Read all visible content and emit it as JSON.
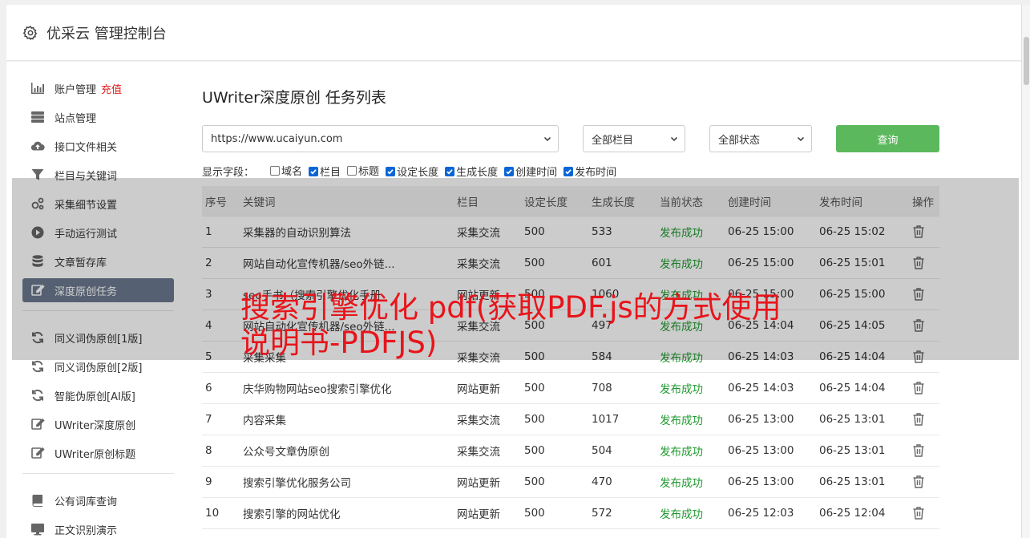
{
  "header": {
    "title": "优采云 管理控制台"
  },
  "sidebar": {
    "group1": [
      {
        "label": "账户管理",
        "badge": "充值",
        "icon": "bar-chart-icon"
      },
      {
        "label": "站点管理",
        "icon": "server-icon"
      },
      {
        "label": "接口文件相关",
        "icon": "cloud-upload-icon"
      },
      {
        "label": "栏目与关键词",
        "icon": "filter-icon"
      },
      {
        "label": "采集细节设置",
        "icon": "gears-icon"
      },
      {
        "label": "手动运行测试",
        "icon": "play-circle-icon"
      },
      {
        "label": "文章暂存库",
        "icon": "database-icon"
      },
      {
        "label": "深度原创任务",
        "icon": "edit-icon",
        "active": true
      }
    ],
    "group2": [
      {
        "label": "同义词伪原创[1版]",
        "icon": "refresh-icon"
      },
      {
        "label": "同义词伪原创[2版]",
        "icon": "refresh-icon"
      },
      {
        "label": "智能伪原创[AI版]",
        "icon": "refresh-icon"
      },
      {
        "label": "UWriter深度原创",
        "icon": "edit-icon"
      },
      {
        "label": "UWriter原创标题",
        "icon": "edit-icon"
      }
    ],
    "group3": [
      {
        "label": "公有词库查询",
        "icon": "book-icon"
      },
      {
        "label": "正文识别演示",
        "icon": "monitor-icon"
      }
    ]
  },
  "page": {
    "title": "UWriter深度原创 任务列表"
  },
  "filters": {
    "site": "https://www.ucaiyun.com",
    "column": "全部栏目",
    "status": "全部状态",
    "query_label": "查询"
  },
  "fields": {
    "label": "显示字段：",
    "options": [
      {
        "label": "域名",
        "checked": false
      },
      {
        "label": "栏目",
        "checked": true
      },
      {
        "label": "标题",
        "checked": false
      },
      {
        "label": "设定长度",
        "checked": true
      },
      {
        "label": "生成长度",
        "checked": true
      },
      {
        "label": "创建时间",
        "checked": true
      },
      {
        "label": "发布时间",
        "checked": true
      }
    ]
  },
  "table": {
    "headers": [
      "序号",
      "关键词",
      "栏目",
      "设定长度",
      "生成长度",
      "当前状态",
      "创建时间",
      "发布时间",
      "操作"
    ],
    "rows": [
      [
        "1",
        "采集器的自动识别算法",
        "采集交流",
        "500",
        "533",
        "发布成功",
        "06-25 15:00",
        "06-25 15:02"
      ],
      [
        "2",
        "网站自动化宣传机器/seo外链...",
        "采集交流",
        "500",
        "601",
        "发布成功",
        "06-25 15:00",
        "06-25 15:01"
      ],
      [
        "3",
        "seo手书（搜索引擎优化手册",
        "网站更新",
        "500",
        "1060",
        "发布成功",
        "06-25 15:00",
        "06-25 15:00"
      ],
      [
        "4",
        "网站自动化宣传机器/seo外链...",
        "采集交流",
        "500",
        "497",
        "发布成功",
        "06-25 14:04",
        "06-25 14:05"
      ],
      [
        "5",
        "采集采集",
        "采集交流",
        "500",
        "584",
        "发布成功",
        "06-25 14:03",
        "06-25 14:04"
      ],
      [
        "6",
        "庆华购物网站seo搜索引擎优化",
        "网站更新",
        "500",
        "708",
        "发布成功",
        "06-25 14:03",
        "06-25 14:04"
      ],
      [
        "7",
        "内容采集",
        "采集交流",
        "500",
        "1017",
        "发布成功",
        "06-25 13:00",
        "06-25 13:01"
      ],
      [
        "8",
        "公众号文章伪原创",
        "采集交流",
        "500",
        "504",
        "发布成功",
        "06-25 13:00",
        "06-25 13:01"
      ],
      [
        "9",
        "搜索引擎优化服务公司",
        "网站更新",
        "500",
        "470",
        "发布成功",
        "06-25 13:00",
        "06-25 13:01"
      ],
      [
        "10",
        "搜索引擎的网站优化",
        "网站更新",
        "500",
        "572",
        "发布成功",
        "06-25 12:03",
        "06-25 12:04"
      ]
    ]
  },
  "overlay": {
    "headline": "搜索引擎优化 pdf(获取PDF.js的方式使用说明书-PDFJS)"
  },
  "colors": {
    "accent_green": "#5cb85c",
    "status_green": "#1e9a2e",
    "headline_red": "#e8141a",
    "sidebar_active": "#6b7a8f"
  }
}
